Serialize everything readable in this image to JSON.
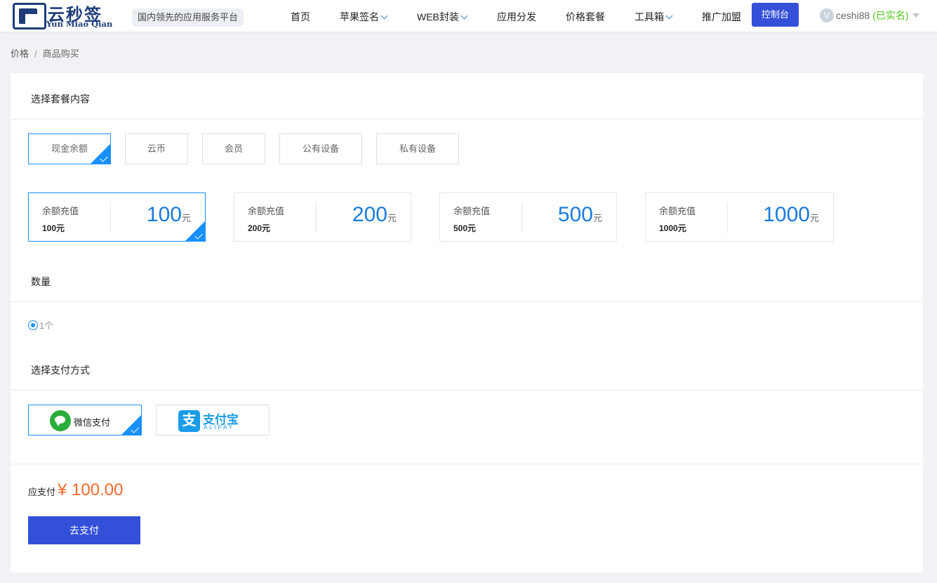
{
  "brand": {
    "name_cn": "云秒签",
    "name_en": "Yun Miao Qian",
    "slogan": "国内领先的应用服务平台"
  },
  "nav": {
    "items": [
      {
        "label": "首页",
        "dropdown": false
      },
      {
        "label": "苹果签名",
        "dropdown": true
      },
      {
        "label": "WEB封装",
        "dropdown": true
      },
      {
        "label": "应用分发",
        "dropdown": false
      },
      {
        "label": "价格套餐",
        "dropdown": false
      },
      {
        "label": "工具箱",
        "dropdown": true
      },
      {
        "label": "推广加盟",
        "dropdown": false
      }
    ],
    "console_label": "控制台"
  },
  "user": {
    "avatar_letter": "V",
    "name": "ceshi88",
    "status": "(已实名)"
  },
  "breadcrumb": {
    "parent": "价格",
    "separator": "/",
    "current": "商品购买"
  },
  "sections": {
    "package_content": "选择套餐内容",
    "quantity": "数量",
    "payment_method": "选择支付方式"
  },
  "categories": [
    {
      "label": "现金余额",
      "selected": true
    },
    {
      "label": "云币",
      "selected": false
    },
    {
      "label": "会员",
      "selected": false
    },
    {
      "label": "公有设备",
      "selected": false
    },
    {
      "label": "私有设备",
      "selected": false
    }
  ],
  "packages": [
    {
      "name": "余额充值",
      "sub": "100元",
      "amount": "100",
      "unit": "元",
      "selected": true
    },
    {
      "name": "余额充值",
      "sub": "200元",
      "amount": "200",
      "unit": "元",
      "selected": false
    },
    {
      "name": "余额充值",
      "sub": "500元",
      "amount": "500",
      "unit": "元",
      "selected": false
    },
    {
      "name": "余额充值",
      "sub": "1000元",
      "amount": "1000",
      "unit": "元",
      "selected": false
    }
  ],
  "quantity": {
    "option_label": "1个",
    "selected": true
  },
  "payment": {
    "wechat": {
      "label": "微信支付",
      "selected": true
    },
    "alipay": {
      "icon_char": "支",
      "label_cn": "支付宝",
      "label_en": "ALIPAY",
      "selected": false
    }
  },
  "total": {
    "label": "应支付",
    "amount": "¥ 100.00"
  },
  "pay_button": "去支付",
  "colors": {
    "primary": "#3450d8",
    "accent_blue": "#1890ff",
    "price_blue": "#1a7be0",
    "amount_orange": "#f56a2b",
    "verified_green": "#52c41a",
    "brand_navy": "#1e3d7a",
    "wechat_green": "#2aae3a",
    "alipay_blue": "#1a9ce8"
  }
}
